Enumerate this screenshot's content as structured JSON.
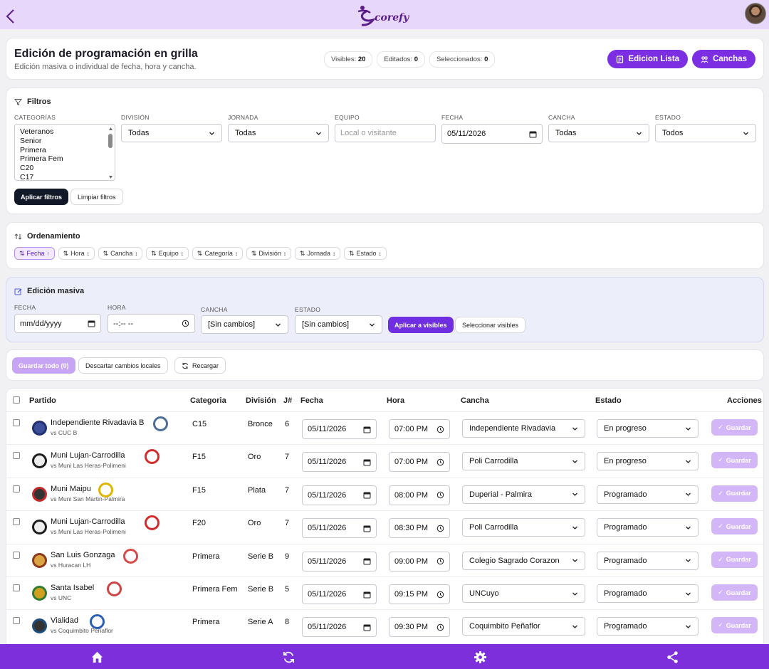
{
  "app": {
    "logo_text": "corefy"
  },
  "header": {
    "title": "Edición de programación en grilla",
    "subtitle": "Edición masiva o individual de fecha, hora y cancha.",
    "stats": [
      {
        "label": "Visibles:",
        "value": "20"
      },
      {
        "label": "Editados:",
        "value": "0"
      },
      {
        "label": "Seleccionados:",
        "value": "0"
      }
    ],
    "btn_list": "Edicion Lista",
    "btn_courts": "Canchas"
  },
  "filters": {
    "title": "Filtros",
    "labels": {
      "categorias": "CATEGORÍAS",
      "division": "DIVISIÓN",
      "jornada": "JORNADA",
      "equipo": "EQUIPO",
      "fecha": "FECHA",
      "cancha": "CANCHA",
      "estado": "ESTADO"
    },
    "categories": [
      "Veteranos",
      "Senior",
      "Primera",
      "Primera Fem",
      "C20",
      "C17"
    ],
    "division_value": "Todas",
    "jornada_value": "Todas",
    "equipo_placeholder": "Local o visitante",
    "fecha_value": "05/11/2026",
    "cancha_value": "Todas",
    "estado_value": "Todos",
    "apply": "Aplicar filtros",
    "clear": "Limpiar filtros"
  },
  "ordering": {
    "title": "Ordenamiento",
    "chips": [
      "Fecha",
      "Hora",
      "Cancha",
      "Equipo",
      "Categoría",
      "División",
      "Jornada",
      "Estado"
    ],
    "active": "Fecha"
  },
  "mass_edit": {
    "title": "Edición masiva",
    "labels": {
      "fecha": "FECHA",
      "hora": "HORA",
      "cancha": "CANCHA",
      "estado": "ESTADO"
    },
    "fecha_placeholder": "mm/dd/yyyy",
    "hora_placeholder": "--:-- --",
    "cancha_value": "[Sin cambios]",
    "estado_value": "[Sin cambios]",
    "apply": "Aplicar a visibles",
    "select": "Seleccionar visibles"
  },
  "actions": {
    "save_all": "Guardar todo (0)",
    "discard": "Descartar cambios locales",
    "reload": "Recargar"
  },
  "table": {
    "headers": [
      "Partido",
      "Categoria",
      "División",
      "J#",
      "Fecha",
      "Hora",
      "Cancha",
      "Estado",
      "Acciones"
    ],
    "save_label": "Guardar",
    "rows": [
      {
        "team": "Independiente Rivadavia B",
        "vs": "vs CUC B",
        "categoria": "C15",
        "division": "Bronce",
        "jornada": "6",
        "fecha": "05/11/2026",
        "hora": "07:00 PM",
        "cancha": "Independiente Rivadavia",
        "estado": "En progreso"
      },
      {
        "team": "Muni Lujan-Carrodilla",
        "vs": "vs Muni Las Heras-Polimeni",
        "categoria": "F15",
        "division": "Oro",
        "jornada": "7",
        "fecha": "05/11/2026",
        "hora": "07:00 PM",
        "cancha": "Poli Carrodilla",
        "estado": "En progreso"
      },
      {
        "team": "Muni Maipu",
        "vs": "vs Muni San Martin-Palmira",
        "categoria": "F15",
        "division": "Plata",
        "jornada": "7",
        "fecha": "05/11/2026",
        "hora": "08:00 PM",
        "cancha": "Duperial - Palmira",
        "estado": "Programado"
      },
      {
        "team": "Muni Lujan-Carrodilla",
        "vs": "vs Muni Las Heras-Polimeni",
        "categoria": "F20",
        "division": "Oro",
        "jornada": "7",
        "fecha": "05/11/2026",
        "hora": "08:30 PM",
        "cancha": "Poli Carrodilla",
        "estado": "Programado"
      },
      {
        "team": "San Luis Gonzaga",
        "vs": "vs Huracan LH",
        "categoria": "Primera",
        "division": "Serie B",
        "jornada": "9",
        "fecha": "05/11/2026",
        "hora": "09:00 PM",
        "cancha": "Colegio Sagrado Corazon",
        "estado": "Programado"
      },
      {
        "team": "Santa Isabel",
        "vs": "vs UNC",
        "categoria": "Primera Fem",
        "division": "Serie B",
        "jornada": "5",
        "fecha": "05/11/2026",
        "hora": "09:15 PM",
        "cancha": "UNCuyo",
        "estado": "Programado"
      },
      {
        "team": "Vialidad",
        "vs": "vs Coquimbito Peñaflor",
        "categoria": "Primera",
        "division": "Serie A",
        "jornada": "8",
        "fecha": "05/11/2026",
        "hora": "09:30 PM",
        "cancha": "Coquimbito Peñaflor",
        "estado": "Programado"
      }
    ]
  },
  "colors": {
    "primary": "#7c2ee3",
    "topbar": "#e7d8fb",
    "bottombar": "#7d2fdc"
  },
  "icons": [
    "back-icon",
    "logo-icon",
    "avatar",
    "list-icon",
    "courts-icon",
    "filter-icon",
    "sort-icon",
    "edit-icon",
    "reload-icon",
    "check-icon",
    "home-icon",
    "refresh-icon",
    "settings-icon",
    "share-icon"
  ]
}
